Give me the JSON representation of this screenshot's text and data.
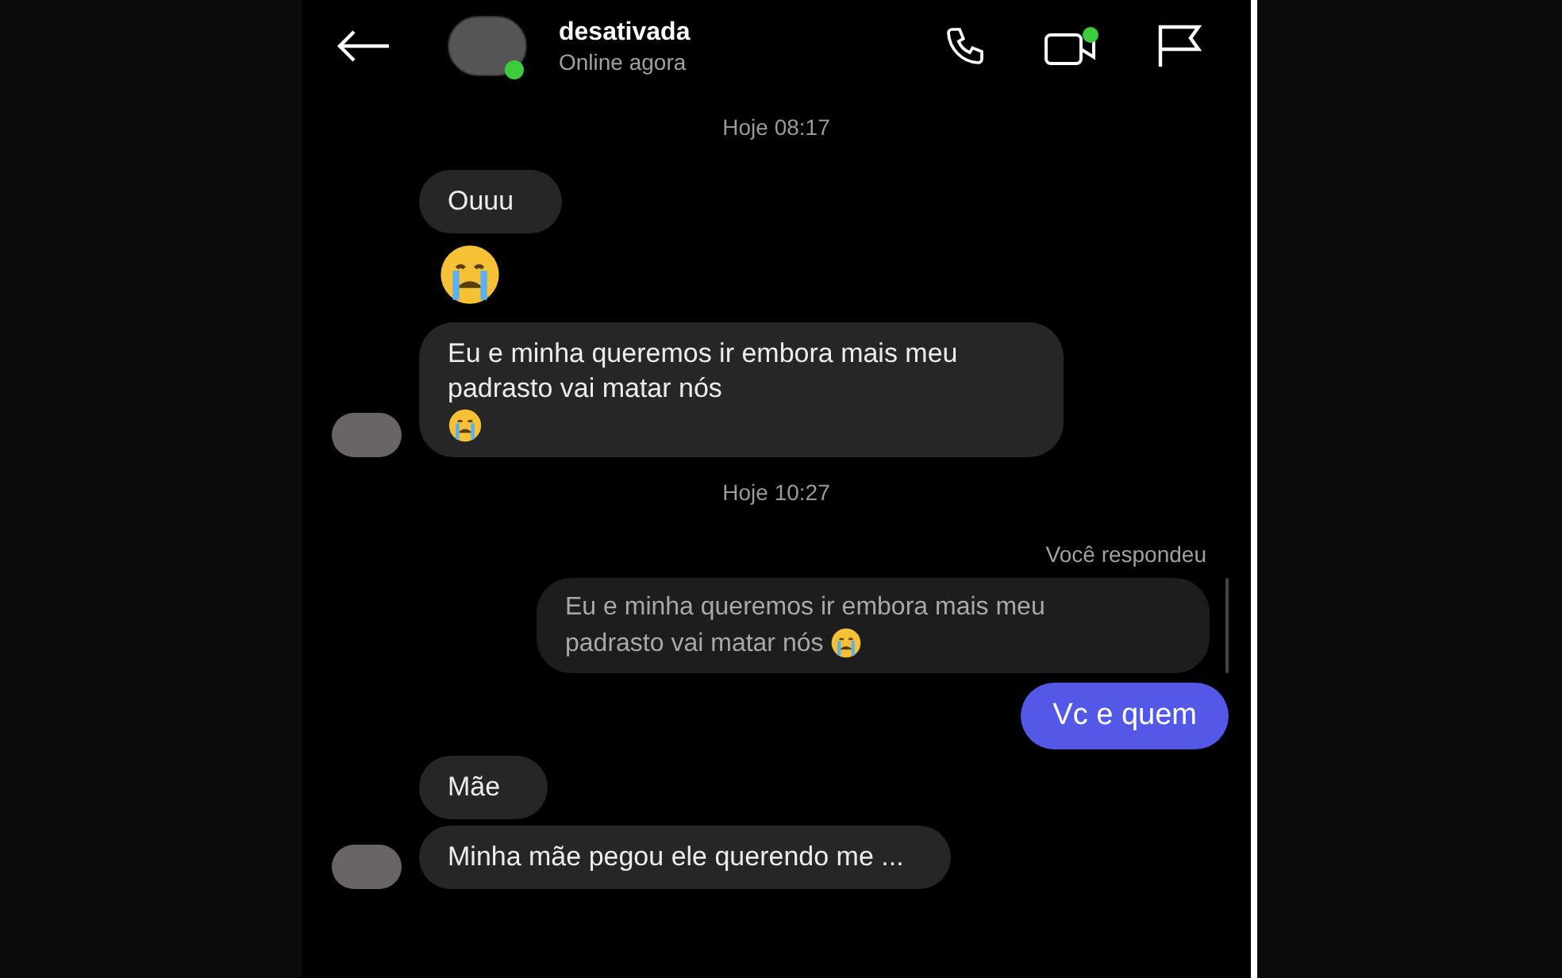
{
  "header": {
    "name": "desativada",
    "status": "Online agora",
    "online": true
  },
  "messages": [
    {
      "kind": "time",
      "text": "Hoje 08:17"
    },
    {
      "kind": "received",
      "text": "Ouuu",
      "emoji_end": false,
      "avatar": false
    },
    {
      "kind": "emoji"
    },
    {
      "kind": "received",
      "text": "Eu e minha queremos ir embora mais meu padrasto vai matar nós",
      "emoji_end": true,
      "avatar": true
    },
    {
      "kind": "time",
      "text": "Hoje 10:27"
    },
    {
      "kind": "reply_label",
      "text": "Você respondeu"
    },
    {
      "kind": "quote",
      "text": "Eu e minha queremos ir embora mais meu padrasto vai matar nós",
      "emoji_end": true
    },
    {
      "kind": "sent",
      "text": "Vc e quem"
    },
    {
      "kind": "received",
      "text": "Mãe",
      "emoji_end": false,
      "avatar": false
    },
    {
      "kind": "received",
      "text": "Minha mãe pegou ele querendo me ...",
      "emoji_end": false,
      "avatar": true
    }
  ]
}
